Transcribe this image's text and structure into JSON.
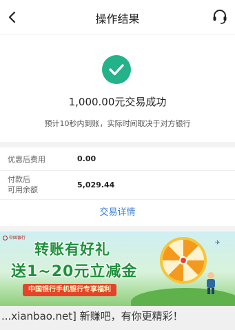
{
  "header": {
    "title": "操作结果",
    "back_icon": "chevron-left-icon",
    "service_icon": "headset-icon"
  },
  "result": {
    "status_icon": "check-circle-icon",
    "amount_text": "1,000.00元交易成功",
    "hint": "预计10秒内到账，实际时间取决于对方银行"
  },
  "details": {
    "rows": [
      {
        "label": "优惠后费用",
        "value": "0.00"
      },
      {
        "label_line1": "付款后",
        "label_line2": "可用余额",
        "value": "5,029.44"
      }
    ],
    "link": "交易详情"
  },
  "banner": {
    "bank_name": "中国银行",
    "headline1": "转账有好礼",
    "headline2": "送1~20元立减金",
    "tagline": "中国银行手机银行专享福利"
  },
  "watermark": "...xianbao.net] 新赚吧，有你更精彩！",
  "colors": {
    "success": "#23b28a",
    "link": "#3a7fd6",
    "banner_green": "#1f8f3b",
    "banner_red": "#e6432a"
  }
}
